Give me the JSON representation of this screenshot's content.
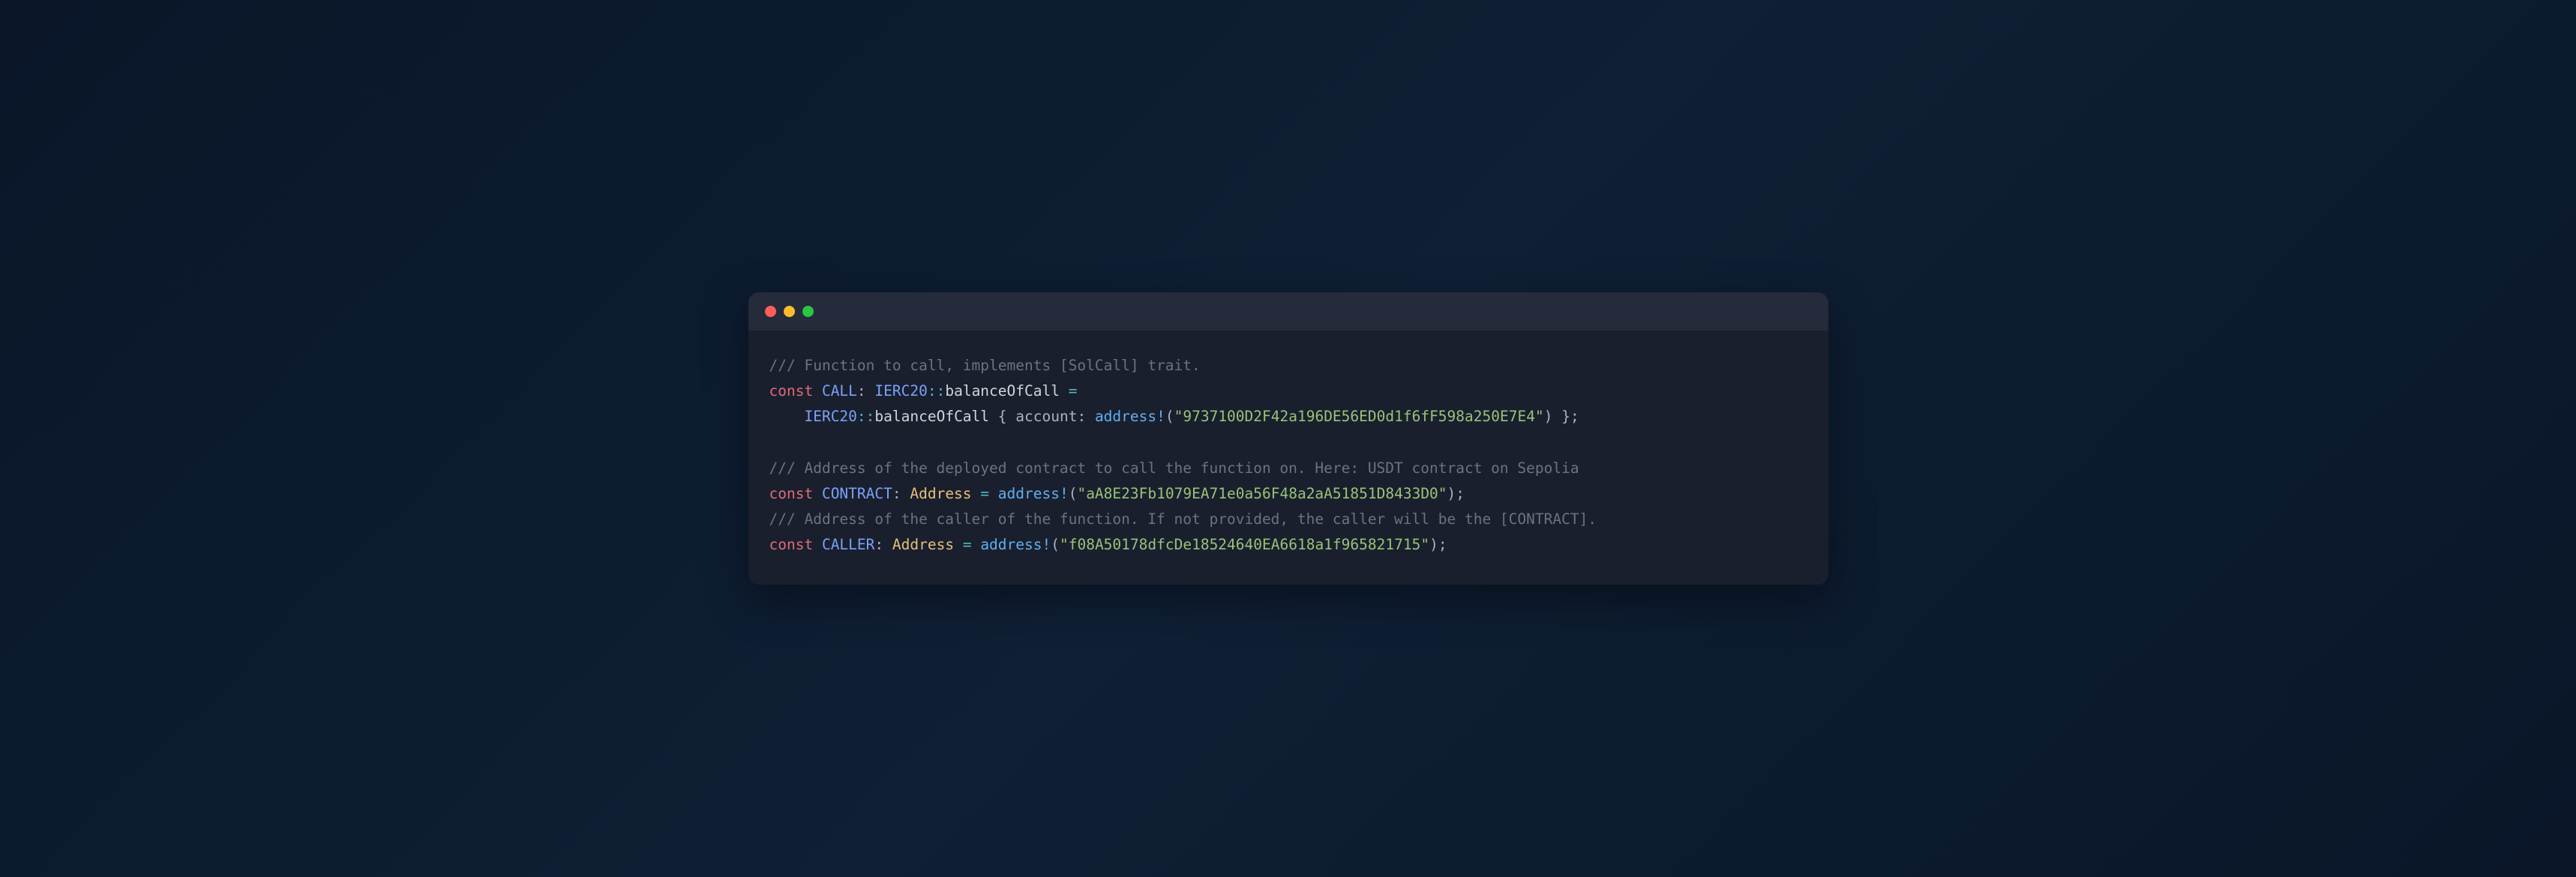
{
  "window": {
    "dots": {
      "red": "#ff5f57",
      "yellow": "#febc2e",
      "green": "#28c840"
    }
  },
  "code": {
    "comment1": "/// Function to call, implements [SolCall] trait.",
    "kw_const": "const",
    "call_name": "CALL",
    "ierc20": "IERC20",
    "dcolon": "::",
    "balanceOfCall": "balanceOfCall",
    "eq": " = ",
    "lbrace": " { ",
    "rbrace": " }",
    "account_key": "account",
    "colon": ": ",
    "address_macro": "address!",
    "lparen": "(",
    "rparen": ")",
    "semi": ";",
    "str_account": "\"9737100D2F42a196DE56ED0d1f6fF598a250E7E4\"",
    "comment2": "/// Address of the deployed contract to call the function on. Here: USDT contract on Sepolia",
    "contract_name": "CONTRACT",
    "address_type": "Address",
    "str_contract": "\"aA8E23Fb1079EA71e0a56F48a2aA51851D8433D0\"",
    "comment3": "/// Address of the caller of the function. If not provided, the caller will be the [CONTRACT].",
    "caller_name": "CALLER",
    "str_caller": "\"f08A50178dfcDe18524640EA6618a1f965821715\"",
    "indent": "    "
  }
}
